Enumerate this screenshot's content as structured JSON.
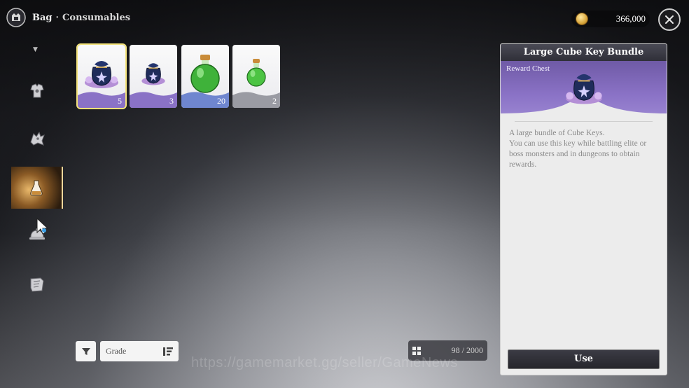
{
  "header": {
    "section": "Bag",
    "separator": "·",
    "category": "Consumables"
  },
  "currency": {
    "icon": "gold-coin-icon",
    "amount": "366,000"
  },
  "nav": {
    "items": [
      {
        "icon": "armor-icon",
        "active": false
      },
      {
        "icon": "dragon-emblem-icon",
        "active": false
      },
      {
        "icon": "potion-flask-icon",
        "active": true
      },
      {
        "icon": "cloche-dish-icon",
        "active": false
      },
      {
        "icon": "scroll-map-icon",
        "active": false
      }
    ]
  },
  "items": [
    {
      "name": "Large Cube Key Bundle",
      "icon": "cube-key-bag-large-icon",
      "count": "5",
      "grade": "purple",
      "selected": true
    },
    {
      "name": "Cube Key Bundle",
      "icon": "cube-key-bag-icon",
      "count": "3",
      "grade": "purple",
      "selected": false
    },
    {
      "name": "Large Potion",
      "icon": "green-potion-large-icon",
      "count": "20",
      "grade": "blue",
      "selected": false
    },
    {
      "name": "Potion",
      "icon": "green-potion-small-icon",
      "count": "2",
      "grade": "gray",
      "selected": false
    }
  ],
  "detail": {
    "title": "Large Cube Key Bundle",
    "kind": "Reward Chest",
    "description": "A large bundle of Cube Keys.\nYou can use this key while battling elite or boss monsters and in dungeons to obtain rewards.",
    "use_label": "Use"
  },
  "controls": {
    "sort_label": "Grade",
    "capacity": "98 / 2000"
  },
  "watermark": "https://gamemarket.gg/seller/GameNews",
  "colors": {
    "selected_outline": "#f3e27a",
    "purple_grade": "#8a72c6",
    "blue_grade": "#6f86cf",
    "gray_grade": "#9a9ba3",
    "nav_active": "#e9b86a"
  }
}
